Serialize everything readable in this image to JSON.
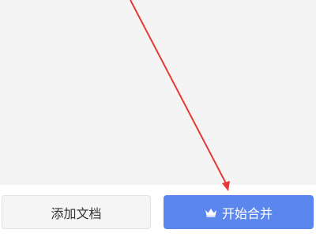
{
  "actions": {
    "add_document_label": "添加文档",
    "start_merge_label": "开始合并",
    "merge_icon": "crown-icon"
  },
  "colors": {
    "background": "#f4f4f4",
    "primary": "#5b86ee",
    "secondary_button": "#f5f5f5",
    "annotation_arrow": "#e53935"
  }
}
